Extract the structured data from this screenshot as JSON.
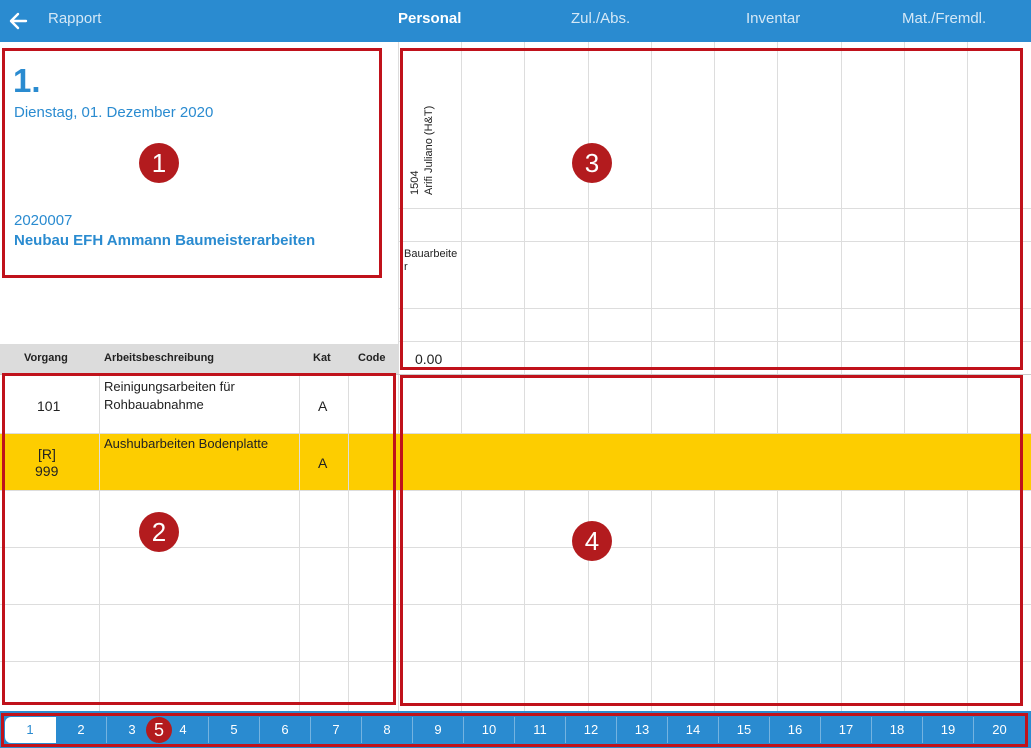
{
  "nav": {
    "back_label": "Rapport",
    "tabs": [
      "Personal",
      "Zul./Abs.",
      "Inventar",
      "Mat./Fremdl."
    ],
    "active_tab": "Personal"
  },
  "info": {
    "number": "1.",
    "date": "Dienstag, 01. Dezember 2020",
    "project_code": "2020007",
    "project_title": "Neubau EFH Ammann Baumeisterarbeiten"
  },
  "table": {
    "headers": [
      "Vorgang",
      "Arbeitsbeschreibung",
      "Kat",
      "Code"
    ],
    "rows": [
      {
        "vorgang": "101",
        "desc_line1": "Reinigungsarbeiten für",
        "desc_line2": "Rohbauabnahme",
        "kat": "A",
        "code": ""
      },
      {
        "vorgang_line1": "[R]",
        "vorgang_line2": "999",
        "desc_line1": "Aushubarbeiten Bodenplatte",
        "kat": "A",
        "code": ""
      }
    ]
  },
  "worker": {
    "number": "1504",
    "name": "Arifi Juliano (H&T)",
    "role": "Bauarbeiter",
    "total": "0.00"
  },
  "annotations": [
    "1",
    "2",
    "3",
    "4",
    "5"
  ],
  "pages": [
    "1",
    "2",
    "3",
    "4",
    "5",
    "6",
    "7",
    "8",
    "9",
    "10",
    "11",
    "12",
    "13",
    "14",
    "15",
    "16",
    "17",
    "18",
    "19",
    "20"
  ],
  "active_page": "1",
  "colors": {
    "accent": "#2a8bd0",
    "highlight_row": "#fdcd00",
    "annotation_red": "#c0121b"
  }
}
